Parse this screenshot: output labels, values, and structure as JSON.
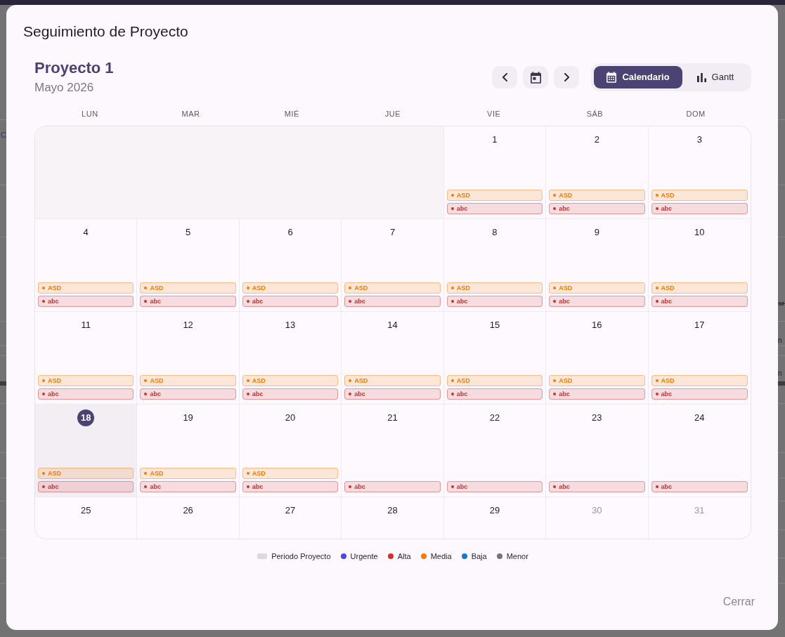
{
  "backdrop": {
    "left_texts": [
      "C"
    ],
    "right_texts": [
      "se",
      "n",
      "n"
    ]
  },
  "dialog": {
    "title": "Seguimiento de Proyecto",
    "project": {
      "name": "Proyecto 1",
      "period": "Mayo 2026"
    },
    "view_tabs": [
      {
        "label": "Calendario",
        "kind": "calendar",
        "selected": true
      },
      {
        "label": "Gantt",
        "kind": "gantt",
        "selected": false
      }
    ],
    "calendar": {
      "weekdays": [
        "LUN",
        "MAR",
        "MIÉ",
        "JUE",
        "VIE",
        "SÁB",
        "DOM"
      ],
      "weeks": [
        [
          {
            "kind": "blank"
          },
          {
            "kind": "blank"
          },
          {
            "kind": "blank"
          },
          {
            "kind": "blank"
          },
          {
            "kind": "day",
            "day": "1",
            "today": false,
            "muted": false,
            "events": [
              {
                "label": "ASD",
                "color": "#f57c00"
              },
              {
                "label": "abc",
                "color": "#d32f2f"
              }
            ]
          },
          {
            "kind": "day",
            "day": "2",
            "today": false,
            "muted": false,
            "events": [
              {
                "label": "ASD",
                "color": "#f57c00"
              },
              {
                "label": "abc",
                "color": "#d32f2f"
              }
            ]
          },
          {
            "kind": "day",
            "day": "3",
            "today": false,
            "muted": false,
            "events": [
              {
                "label": "ASD",
                "color": "#f57c00"
              },
              {
                "label": "abc",
                "color": "#d32f2f"
              }
            ]
          }
        ],
        [
          {
            "kind": "day",
            "day": "4",
            "today": false,
            "muted": false,
            "events": [
              {
                "label": "ASD",
                "color": "#f57c00"
              },
              {
                "label": "abc",
                "color": "#d32f2f"
              }
            ]
          },
          {
            "kind": "day",
            "day": "5",
            "today": false,
            "muted": false,
            "events": [
              {
                "label": "ASD",
                "color": "#f57c00"
              },
              {
                "label": "abc",
                "color": "#d32f2f"
              }
            ]
          },
          {
            "kind": "day",
            "day": "6",
            "today": false,
            "muted": false,
            "events": [
              {
                "label": "ASD",
                "color": "#f57c00"
              },
              {
                "label": "abc",
                "color": "#d32f2f"
              }
            ]
          },
          {
            "kind": "day",
            "day": "7",
            "today": false,
            "muted": false,
            "events": [
              {
                "label": "ASD",
                "color": "#f57c00"
              },
              {
                "label": "abc",
                "color": "#d32f2f"
              }
            ]
          },
          {
            "kind": "day",
            "day": "8",
            "today": false,
            "muted": false,
            "events": [
              {
                "label": "ASD",
                "color": "#f57c00"
              },
              {
                "label": "abc",
                "color": "#d32f2f"
              }
            ]
          },
          {
            "kind": "day",
            "day": "9",
            "today": false,
            "muted": false,
            "events": [
              {
                "label": "ASD",
                "color": "#f57c00"
              },
              {
                "label": "abc",
                "color": "#d32f2f"
              }
            ]
          },
          {
            "kind": "day",
            "day": "10",
            "today": false,
            "muted": false,
            "events": [
              {
                "label": "ASD",
                "color": "#f57c00"
              },
              {
                "label": "abc",
                "color": "#d32f2f"
              }
            ]
          }
        ],
        [
          {
            "kind": "day",
            "day": "11",
            "today": false,
            "muted": false,
            "events": [
              {
                "label": "ASD",
                "color": "#f57c00"
              },
              {
                "label": "abc",
                "color": "#d32f2f"
              }
            ]
          },
          {
            "kind": "day",
            "day": "12",
            "today": false,
            "muted": false,
            "events": [
              {
                "label": "ASD",
                "color": "#f57c00"
              },
              {
                "label": "abc",
                "color": "#d32f2f"
              }
            ]
          },
          {
            "kind": "day",
            "day": "13",
            "today": false,
            "muted": false,
            "events": [
              {
                "label": "ASD",
                "color": "#f57c00"
              },
              {
                "label": "abc",
                "color": "#d32f2f"
              }
            ]
          },
          {
            "kind": "day",
            "day": "14",
            "today": false,
            "muted": false,
            "events": [
              {
                "label": "ASD",
                "color": "#f57c00"
              },
              {
                "label": "abc",
                "color": "#d32f2f"
              }
            ]
          },
          {
            "kind": "day",
            "day": "15",
            "today": false,
            "muted": false,
            "events": [
              {
                "label": "ASD",
                "color": "#f57c00"
              },
              {
                "label": "abc",
                "color": "#d32f2f"
              }
            ]
          },
          {
            "kind": "day",
            "day": "16",
            "today": false,
            "muted": false,
            "events": [
              {
                "label": "ASD",
                "color": "#f57c00"
              },
              {
                "label": "abc",
                "color": "#d32f2f"
              }
            ]
          },
          {
            "kind": "day",
            "day": "17",
            "today": false,
            "muted": false,
            "events": [
              {
                "label": "ASD",
                "color": "#f57c00"
              },
              {
                "label": "abc",
                "color": "#d32f2f"
              }
            ]
          }
        ],
        [
          {
            "kind": "day",
            "day": "18",
            "today": true,
            "muted": false,
            "events": [
              {
                "label": "ASD",
                "color": "#f57c00"
              },
              {
                "label": "abc",
                "color": "#d32f2f"
              }
            ]
          },
          {
            "kind": "day",
            "day": "19",
            "today": false,
            "muted": false,
            "events": [
              {
                "label": "ASD",
                "color": "#f57c00"
              },
              {
                "label": "abc",
                "color": "#d32f2f"
              }
            ]
          },
          {
            "kind": "day",
            "day": "20",
            "today": false,
            "muted": false,
            "events": [
              {
                "label": "ASD",
                "color": "#f57c00"
              },
              {
                "label": "abc",
                "color": "#d32f2f"
              }
            ]
          },
          {
            "kind": "day",
            "day": "21",
            "today": false,
            "muted": false,
            "events": [
              {
                "label": "abc",
                "color": "#d32f2f"
              }
            ]
          },
          {
            "kind": "day",
            "day": "22",
            "today": false,
            "muted": false,
            "events": [
              {
                "label": "abc",
                "color": "#d32f2f"
              }
            ]
          },
          {
            "kind": "day",
            "day": "23",
            "today": false,
            "muted": false,
            "events": [
              {
                "label": "abc",
                "color": "#d32f2f"
              }
            ]
          },
          {
            "kind": "day",
            "day": "24",
            "today": false,
            "muted": false,
            "events": [
              {
                "label": "abc",
                "color": "#d32f2f"
              }
            ]
          }
        ],
        [
          {
            "kind": "day",
            "day": "25",
            "today": false,
            "muted": false
          },
          {
            "kind": "day",
            "day": "26",
            "today": false,
            "muted": false
          },
          {
            "kind": "day",
            "day": "27",
            "today": false,
            "muted": false
          },
          {
            "kind": "day",
            "day": "28",
            "today": false,
            "muted": false
          },
          {
            "kind": "day",
            "day": "29",
            "today": false,
            "muted": false
          },
          {
            "kind": "day",
            "day": "30",
            "today": false,
            "muted": true
          },
          {
            "kind": "day",
            "day": "31",
            "today": false,
            "muted": true
          }
        ]
      ]
    },
    "legend": [
      {
        "label": "Periodo Proyecto",
        "kind": "swatch",
        "color": "#dcd8e2"
      },
      {
        "label": "Urgente",
        "kind": "dot",
        "color": "#5046e5"
      },
      {
        "label": "Alta",
        "kind": "dot",
        "color": "#d32f2f"
      },
      {
        "label": "Media",
        "kind": "dot",
        "color": "#f57c00"
      },
      {
        "label": "Baja",
        "kind": "dot",
        "color": "#1976d2"
      },
      {
        "label": "Menor",
        "kind": "dot",
        "color": "#757575"
      }
    ],
    "close_button": "Cerrar"
  }
}
